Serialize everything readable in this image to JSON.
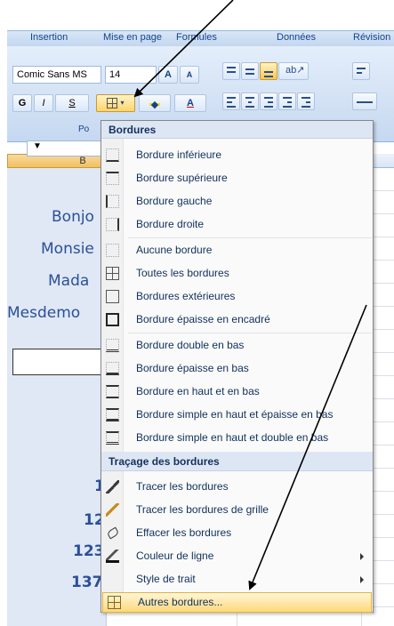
{
  "ribbon": {
    "tabs": [
      "Insertion",
      "Mise en page",
      "Formules",
      "Données",
      "Révision"
    ],
    "font_name": "Comic Sans MS",
    "font_size": "14",
    "grow_font_label": "A",
    "shrink_font_label": "A",
    "bold_label": "G",
    "italic_label": "I",
    "underline_label": "S",
    "font_color_label": "A",
    "group_label": "Po"
  },
  "sheet": {
    "column_b_header": "B",
    "cells": [
      {
        "text": "Bonjo"
      },
      {
        "text": "Monsie"
      },
      {
        "text": "Mada"
      },
      {
        "text": "Mesdemo"
      }
    ],
    "numbers": [
      {
        "text": "1"
      },
      {
        "text": "12"
      },
      {
        "text": "123"
      },
      {
        "text": "137"
      }
    ]
  },
  "menu": {
    "header_borders": "Bordures",
    "items_borders": [
      {
        "label": "Bordure inférieure",
        "icon": "border-bottom-icon"
      },
      {
        "label": "Bordure supérieure",
        "icon": "border-top-icon"
      },
      {
        "label": "Bordure gauche",
        "icon": "border-left-icon"
      },
      {
        "label": "Bordure droite",
        "icon": "border-right-icon"
      },
      {
        "label": "Aucune bordure",
        "icon": "no-border-icon"
      },
      {
        "label": "Toutes les bordures",
        "icon": "all-borders-icon"
      },
      {
        "label": "Bordures extérieures",
        "icon": "outside-borders-icon"
      },
      {
        "label": "Bordure épaisse en encadré",
        "icon": "thick-box-border-icon"
      },
      {
        "label": "Bordure double en bas",
        "icon": "bottom-double-border-icon"
      },
      {
        "label": "Bordure épaisse en bas",
        "icon": "thick-bottom-border-icon"
      },
      {
        "label": "Bordure en haut et en bas",
        "icon": "top-bottom-border-icon"
      },
      {
        "label": "Bordure simple en haut et épaisse en bas",
        "icon": "top-thick-bottom-border-icon"
      },
      {
        "label": "Bordure simple en haut et double en bas",
        "icon": "top-double-bottom-border-icon"
      }
    ],
    "header_draw": "Traçage des bordures",
    "items_draw": [
      {
        "label": "Tracer les bordures",
        "icon": "draw-border-icon"
      },
      {
        "label": "Tracer les bordures de grille",
        "icon": "draw-border-grid-icon"
      },
      {
        "label": "Effacer les bordures",
        "icon": "erase-border-icon"
      },
      {
        "label": "Couleur de ligne",
        "icon": "line-color-icon",
        "submenu": true
      },
      {
        "label": "Style de trait",
        "icon": "line-style-icon",
        "submenu": true
      }
    ],
    "more_borders": {
      "label": "Autres bordures...",
      "icon": "more-borders-icon"
    }
  },
  "colors": {
    "highlight": "#ffd97a",
    "menu_text": "#10305a",
    "cell_text": "#2b4f9a"
  }
}
